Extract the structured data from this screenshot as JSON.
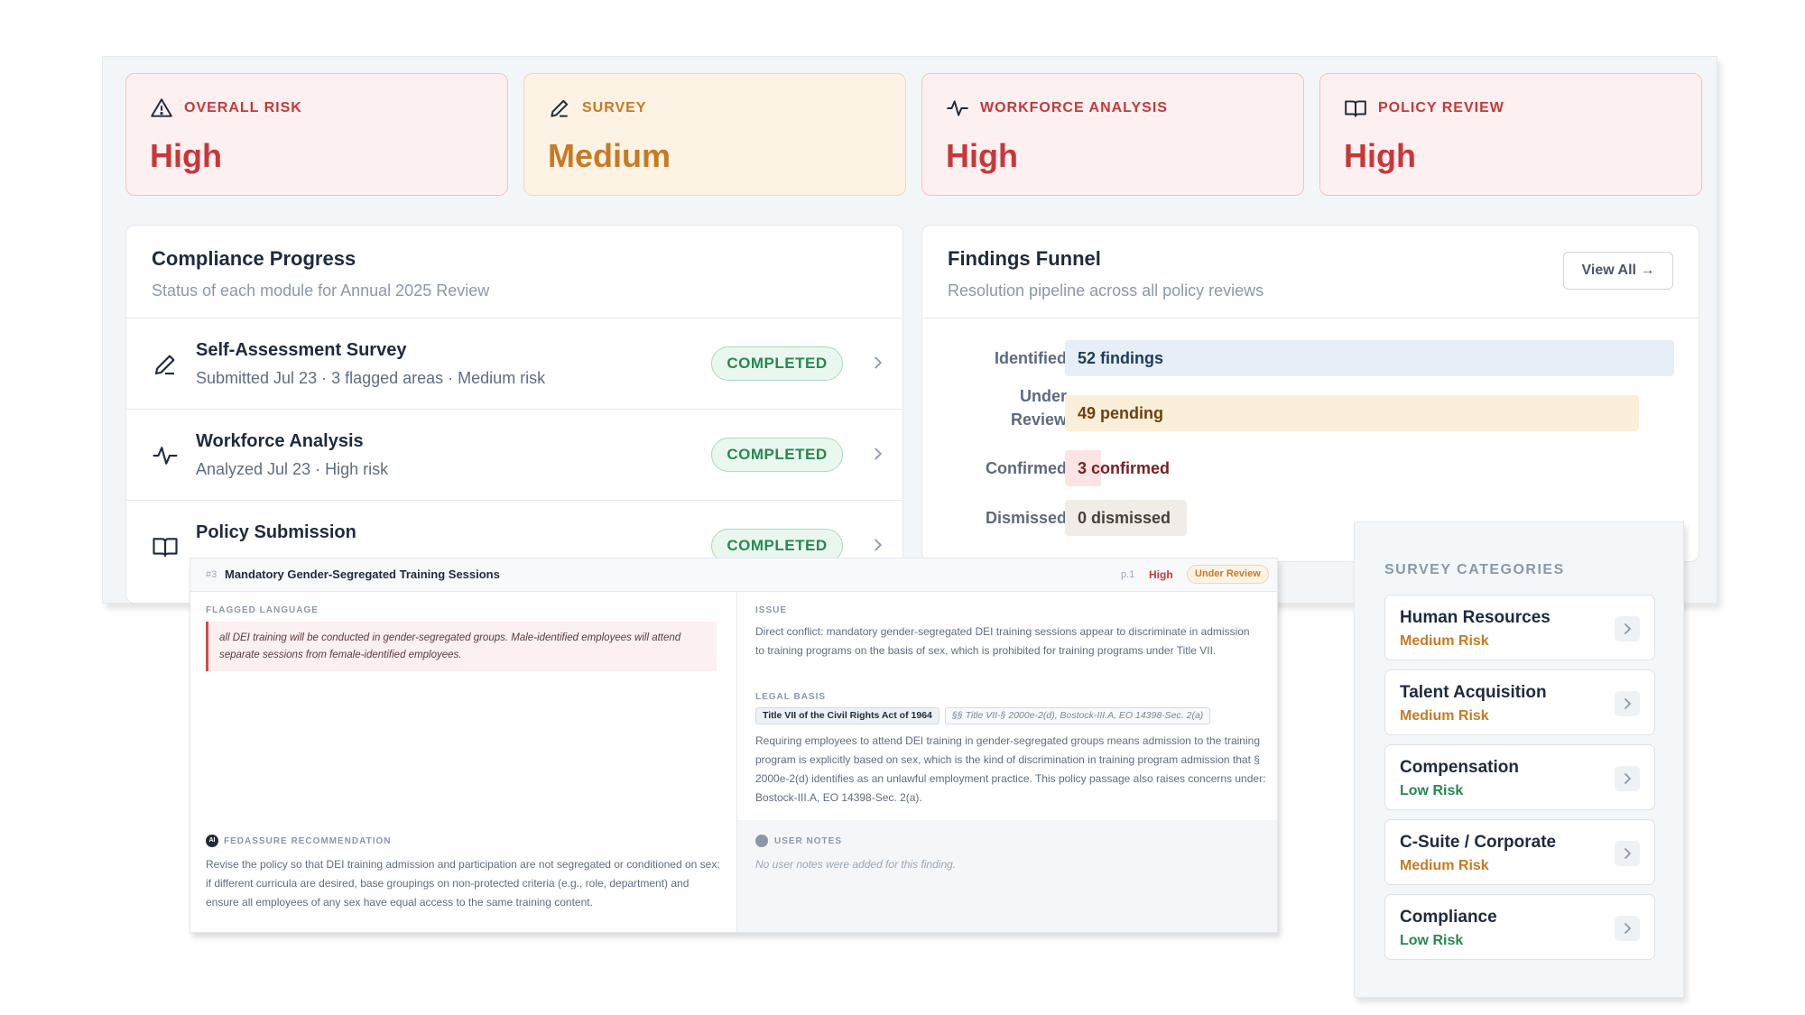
{
  "risk_cards": [
    {
      "label": "OVERALL RISK",
      "value": "High",
      "level": "high",
      "icon": "warning-triangle-icon"
    },
    {
      "label": "SURVEY",
      "value": "Medium",
      "level": "medium",
      "icon": "pen-icon"
    },
    {
      "label": "WORKFORCE ANALYSIS",
      "value": "High",
      "level": "high",
      "icon": "activity-pulse-icon"
    },
    {
      "label": "POLICY REVIEW",
      "value": "High",
      "level": "high",
      "icon": "open-book-icon"
    }
  ],
  "compliance": {
    "title": "Compliance Progress",
    "subtitle": "Status of each module for Annual 2025 Review",
    "modules": [
      {
        "title": "Self-Assessment Survey",
        "meta": "Submitted Jul 23 · 3 flagged areas · Medium risk",
        "status": "COMPLETED",
        "icon": "pen-icon"
      },
      {
        "title": "Workforce Analysis",
        "meta": "Analyzed Jul 23 · High risk",
        "status": "COMPLETED",
        "icon": "activity-pulse-icon"
      },
      {
        "title": "Policy Submission",
        "meta": "",
        "status": "COMPLETED",
        "icon": "open-book-icon"
      }
    ]
  },
  "funnel": {
    "title": "Findings Funnel",
    "subtitle": "Resolution pipeline across all policy reviews",
    "view_all": "View All →",
    "rows": [
      {
        "label_line1": "Identified",
        "label_line2": "",
        "text": "52 findings",
        "count": 52
      },
      {
        "label_line1": "Under",
        "label_line2": "Review",
        "text": "49 pending",
        "count": 49
      },
      {
        "label_line1": "Confirmed",
        "label_line2": "",
        "text": "3 confirmed",
        "count": 3
      },
      {
        "label_line1": "Dismissed",
        "label_line2": "",
        "text": "0 dismissed",
        "count": 0
      }
    ]
  },
  "finding": {
    "number": "#3",
    "title": "Mandatory Gender-Segregated Training Sessions",
    "page": "p.1",
    "severity": "High",
    "status": "Under Review",
    "flagged_label": "FLAGGED LANGUAGE",
    "flagged_text": "all DEI training will be conducted in gender-segregated groups. Male-identified employees will attend separate sessions from female-identified employees.",
    "issue_label": "ISSUE",
    "issue_text": "Direct conflict: mandatory gender-segregated DEI training sessions appear to discriminate in admission to training programs on the basis of sex, which is prohibited for training programs under Title VII.",
    "legal_label": "LEGAL BASIS",
    "legal_chip": "Title VII of the Civil Rights Act of 1964",
    "legal_refs": "§§ Title VII-§ 2000e-2(d), Bostock-III.A, EO 14398-Sec. 2(a)",
    "legal_text": "Requiring employees to attend DEI training in gender-segregated groups means admission to the training program is explicitly based on sex, which is the kind of discrimination in training program admission that § 2000e-2(d) identifies as an unlawful employment practice. This policy passage also raises concerns under: Bostock-III.A, EO 14398-Sec. 2(a).",
    "rec_label": "FEDASSURE RECOMMENDATION",
    "rec_badge": "AI",
    "rec_text": "Revise the policy so that DEI training admission and participation are not segregated or conditioned on sex; if different curricula are desired, base groupings on non-protected criteria (e.g., role, department) and ensure all employees of any sex have equal access to the same training content.",
    "notes_label": "USER NOTES",
    "notes_text": "No user notes were added for this finding."
  },
  "categories": {
    "title": "SURVEY CATEGORIES",
    "items": [
      {
        "name": "Human Resources",
        "risk": "Medium Risk",
        "level": "medium"
      },
      {
        "name": "Talent Acquisition",
        "risk": "Medium Risk",
        "level": "medium"
      },
      {
        "name": "Compensation",
        "risk": "Low Risk",
        "level": "low"
      },
      {
        "name": "C-Suite / Corporate",
        "risk": "Medium Risk",
        "level": "medium"
      },
      {
        "name": "Compliance",
        "risk": "Low Risk",
        "level": "low"
      }
    ]
  },
  "colors": {
    "high": "#c8373a",
    "medium": "#c77a22",
    "low": "#26894f",
    "identified_bar": "#e6eff8",
    "review_bar": "#fbefd9",
    "confirmed_bar": "#fde4e4",
    "dismissed_bar": "#f1ece7"
  }
}
